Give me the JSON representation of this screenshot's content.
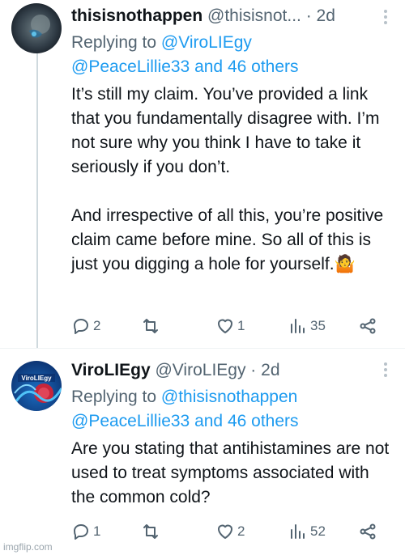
{
  "tweets": [
    {
      "name": "thisisnothappen",
      "handle": "@thisisnot...",
      "time": "2d",
      "replying_label": "Replying to",
      "replying_to_1": "@ViroLIEgy",
      "replying_to_2": "@PeaceLillie33 and 46 others",
      "body": "It’s still my claim. You’ve provided a link that you fundamentally disagree with. I’m not sure why you think I have to take it seriously if you don’t.\n\nAnd irrespective of all this, you’re positive claim came before mine. So all of this is just you digging a hole for yourself.",
      "emoji": "🤷",
      "replies": "2",
      "retweets": "",
      "likes": "1",
      "views": "35"
    },
    {
      "name": "ViroLIEgy",
      "handle": "@ViroLIEgy",
      "time": "2d",
      "replying_label": "Replying to",
      "replying_to_1": "@thisisnothappen",
      "replying_to_2": "@PeaceLillie33 and 46 others",
      "avatar_text": "ViroLIEgy",
      "body": "Are you stating that antihistamines are not used to treat symptoms associated with the common cold?",
      "replies": "1",
      "retweets": "",
      "likes": "2",
      "views": "52"
    }
  ],
  "watermark": "imgflip.com",
  "icons": {
    "reply": "reply-icon",
    "retweet": "retweet-icon",
    "like": "heart-icon",
    "views": "views-icon",
    "share": "share-icon",
    "more": "more-icon"
  }
}
